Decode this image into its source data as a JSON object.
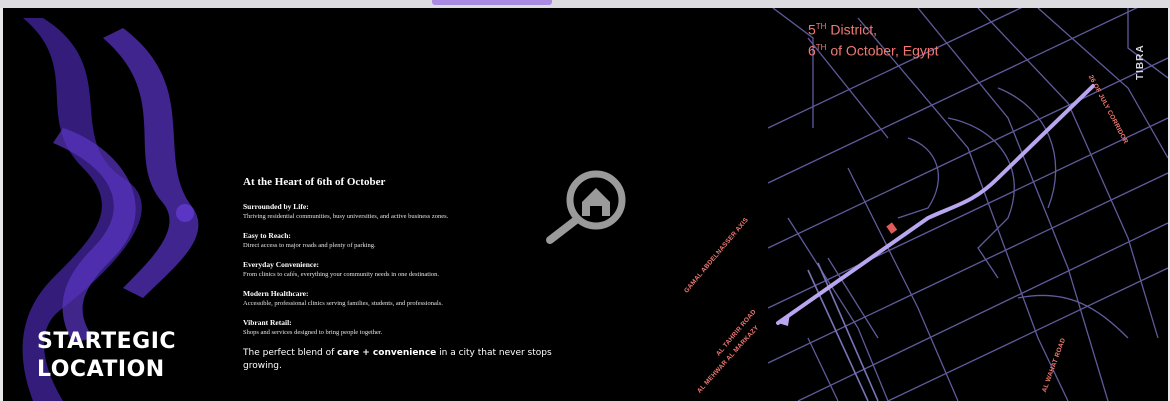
{
  "page": {
    "title": "STARTEGIC LOCATION",
    "title_line1": "STARTEGIC",
    "title_line2": "LOCATION"
  },
  "content": {
    "heading": "At the Heart of 6th of October",
    "items": [
      {
        "title": "Surrounded by Life:",
        "desc": "Thriving residential communities, busy universities, and active business zones."
      },
      {
        "title": "Easy to Reach:",
        "desc": "Direct access to major roads and plenty of parking."
      },
      {
        "title": "Everyday Convenience:",
        "desc": "From clinics to cafés, everything your community needs in one destination."
      },
      {
        "title": "Modern Healthcare:",
        "desc": "Accessible, professional clinics serving families, students, and professionals."
      },
      {
        "title": "Vibrant Retail:",
        "desc": "Shops and services designed to bring people together."
      }
    ],
    "closing_prefix": "The perfect blend of ",
    "closing_bold": "care + convenience",
    "closing_suffix": " in a city that never stops growing."
  },
  "map": {
    "district_line1_num": "5",
    "district_line1_sup": "TH",
    "district_line1_rest": " District,",
    "district_line2_num": "6",
    "district_line2_sup": "TH",
    "district_line2_rest": " of October, Egypt",
    "tibra": "TIBRA",
    "roads": {
      "corridor": "26 OF JULY CORRIDOR",
      "gamal": "GAMAL ABDELNASSER AXIS",
      "tahrir": "AL TAHRIR ROAD",
      "mehwar": "AL MEHWAR AL MARKAZY",
      "wahat": "AL WAHAT ROAD"
    }
  },
  "colors": {
    "background": "#000000",
    "accent_purple": "#4a2a9c",
    "road_lines": "#6e6aa8",
    "highlight_road": "#b9a6f0",
    "label_coral": "#f07a73",
    "marker": "#e05a5a"
  },
  "icons": {
    "search_home": "search-home-icon"
  }
}
